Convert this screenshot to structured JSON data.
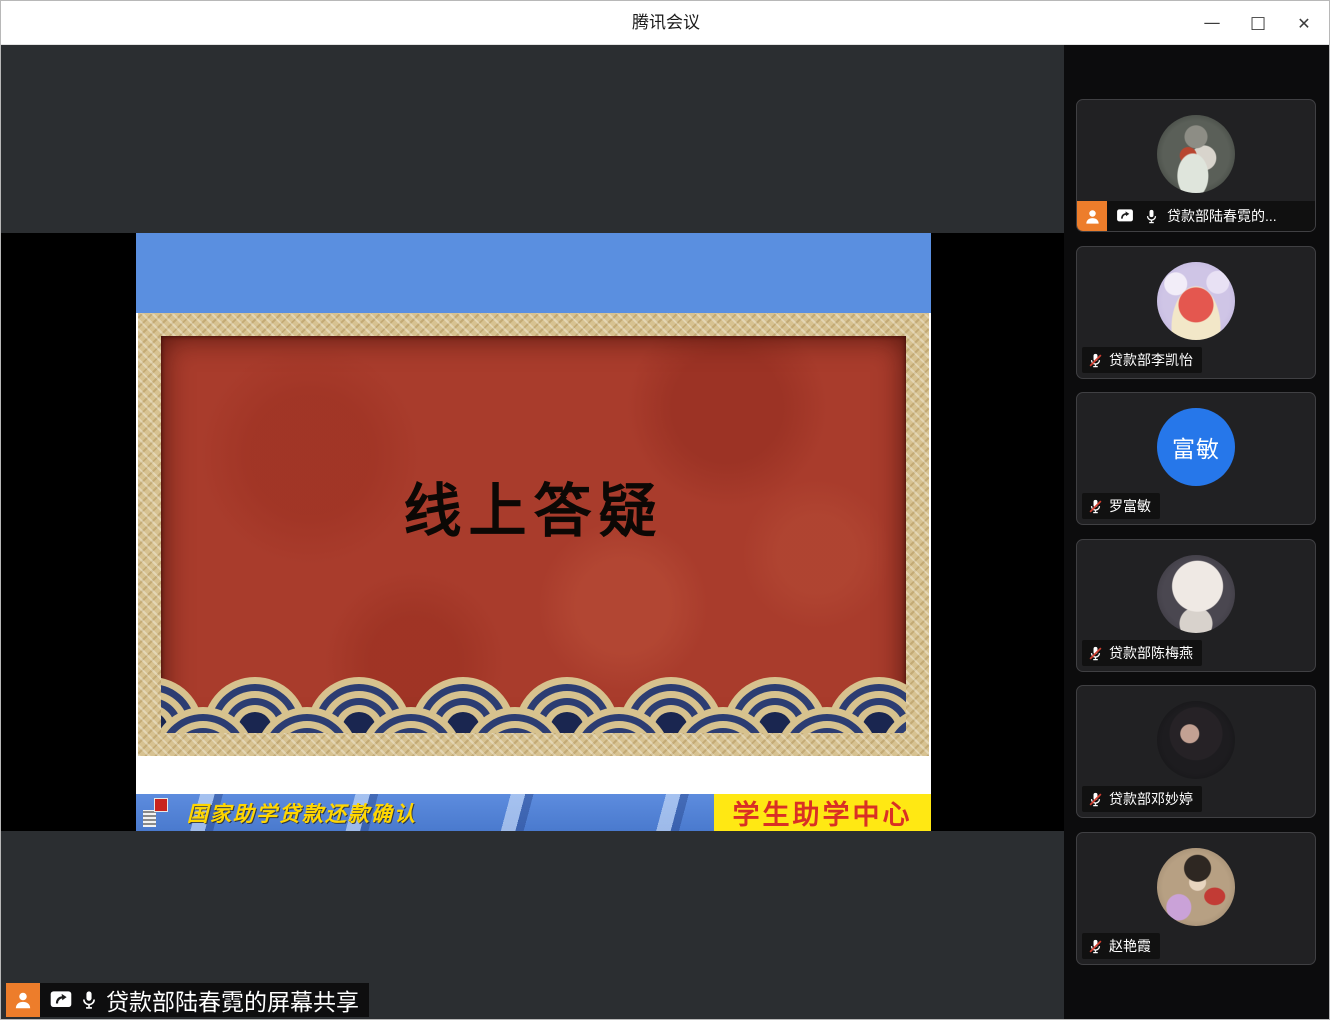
{
  "window": {
    "title": "腾讯会议",
    "controls": {
      "minimize": "—",
      "maximize": "□",
      "close": "✕"
    }
  },
  "screen_share": {
    "slide": {
      "title": "线上答疑",
      "footer_left": "国家助学贷款还款确认",
      "footer_right": "学生助学中心"
    },
    "indicator": {
      "text": "贷款部陆春霓的屏幕共享"
    }
  },
  "sidebar": {
    "participants": [
      {
        "name": "贷款部陆春霓的...",
        "muted": false,
        "sharing": true,
        "avatar": "photo-woman-with-flowers"
      },
      {
        "name": "贷款部李凯怡",
        "muted": true,
        "avatar": "cartoon-red-blob"
      },
      {
        "name": "罗富敏",
        "muted": true,
        "avatar": "initials",
        "avatar_text": "富敏",
        "avatar_color": "#2677ea"
      },
      {
        "name": "贷款部陈梅燕",
        "muted": true,
        "avatar": "white-cat-anime"
      },
      {
        "name": "贷款部邓妙婷",
        "muted": true,
        "avatar": "dark-portrait"
      },
      {
        "name": "赵艳霞",
        "muted": true,
        "avatar": "anime-boy"
      }
    ]
  },
  "colors": {
    "slide_blue": "#5a8fe0",
    "slide_red_panel": "#a93c2c",
    "frame_gold": "#d7c291",
    "footer_yellow": "#ffe813",
    "footer_text_red": "#d93025",
    "footer_text_yellow": "#ffd600",
    "presenter_badge_orange": "#ed7d2b",
    "muted_slash_red": "#d23f31",
    "initials_avatar_blue": "#2677ea"
  }
}
